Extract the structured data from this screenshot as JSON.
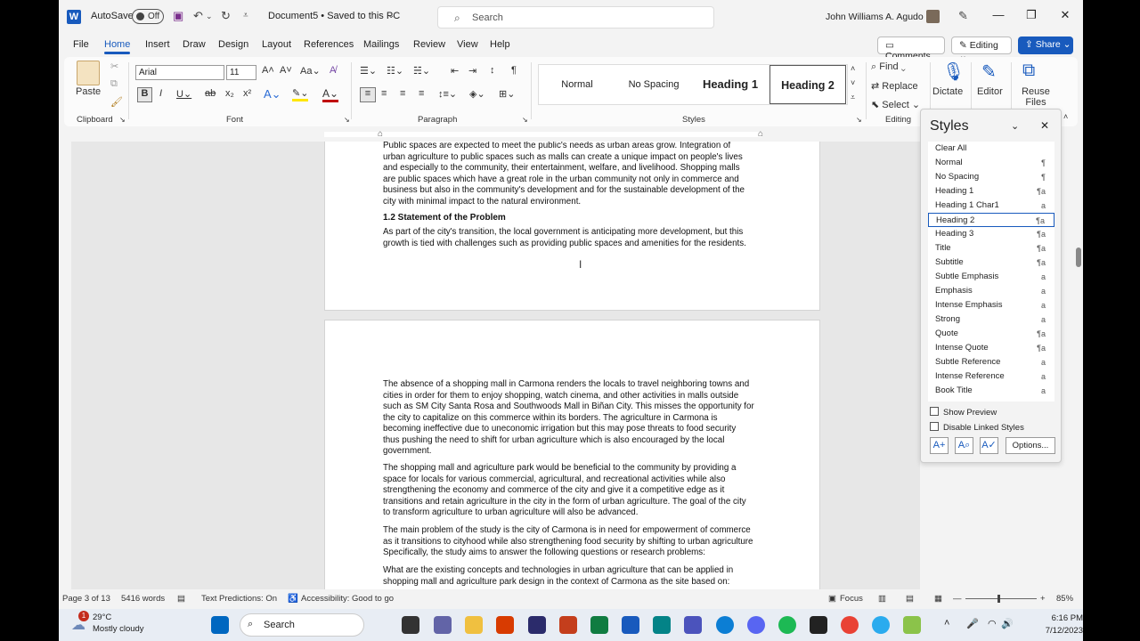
{
  "titlebar": {
    "autosave_label": "AutoSave",
    "autosave_state": "Off",
    "doc_title": "Document5 • Saved to this PC",
    "search_placeholder": "Search",
    "user_name": "John Williams A. Agudo"
  },
  "menu": {
    "items": [
      "File",
      "Home",
      "Insert",
      "Draw",
      "Design",
      "Layout",
      "References",
      "Mailings",
      "Review",
      "View",
      "Help"
    ],
    "active": "Home",
    "comments": "Comments",
    "editing": "Editing",
    "share": "Share"
  },
  "ribbon": {
    "clipboard": {
      "paste": "Paste",
      "label": "Clipboard"
    },
    "font": {
      "family": "Arial",
      "size": "11",
      "label": "Font"
    },
    "paragraph": {
      "label": "Paragraph"
    },
    "styles": {
      "label": "Styles",
      "tiles": [
        "Normal",
        "No Spacing",
        "Heading 1",
        "Heading 2"
      ],
      "selected": "Heading 2"
    },
    "editing": {
      "find": "Find",
      "replace": "Replace",
      "select": "Select",
      "label": "Editing"
    },
    "voice": {
      "dictate": "Dictate"
    },
    "editor": {
      "editor": "Editor"
    },
    "reuse": {
      "reuse": "Reuse Files"
    }
  },
  "page1": {
    "lines": [
      "Public spaces are expected to meet the public's needs as urban areas grow. Integration of",
      "urban agriculture to public spaces such as malls can create a unique impact on people's lives",
      "and especially to the community, their entertainment, welfare, and livelihood. Shopping malls",
      "are public spaces which have a great role in the urban community not only in commerce and",
      "business but also in the community's development and for the sustainable development of the",
      "city with minimal impact to the natural environment."
    ],
    "heading": "1.2 Statement of the Problem",
    "para2": [
      "As part of the city's transition, the local government is anticipating more development, but this",
      "growth is tied with challenges such as providing public spaces and amenities for the residents."
    ]
  },
  "page2": {
    "paragraphs": [
      [
        "The absence of a shopping mall in Carmona renders the locals to travel neighboring towns and",
        "cities in order for them to enjoy shopping, watch cinema, and other activities in malls outside",
        "such as SM City Santa Rosa and Southwoods Mall in Biñan City. This misses the opportunity for",
        "the city to capitalize on this commerce within its borders. The agriculture in Carmona is",
        "becoming ineffective due to uneconomic irrigation but this may pose threats to food security",
        "thus pushing the need to shift for urban agriculture which is also encouraged by the local",
        "government."
      ],
      [
        "The shopping mall and agriculture park would be beneficial to the community by providing a",
        "space for locals for various commercial, agricultural, and recreational activities while also",
        "strengthening the economy and commerce of the city and give it a competitive edge as it",
        "transitions and retain agriculture in the city in the form of urban agriculture. The goal of the city",
        "to transform agriculture to urban agriculture will also be advanced."
      ],
      [
        "The main problem of the study is the city of Carmona is in need for empowerment of commerce",
        "as it transitions to cityhood while also strengthening food security by shifting to urban agriculture",
        "Specifically, the study aims to answer the following questions or research problems:"
      ],
      [
        "What are the existing concepts and technologies in urban agriculture that can be applied in",
        "shopping mall and agriculture park design in the context of Carmona as the site based on:"
      ]
    ]
  },
  "styles_pane": {
    "title": "Styles",
    "items": [
      {
        "name": "Clear All",
        "mark": ""
      },
      {
        "name": "Normal",
        "mark": "¶"
      },
      {
        "name": "No Spacing",
        "mark": "¶"
      },
      {
        "name": "Heading 1",
        "mark": "¶a"
      },
      {
        "name": "Heading 1 Char1",
        "mark": "a"
      },
      {
        "name": "Heading 2",
        "mark": "¶a"
      },
      {
        "name": "Heading 3",
        "mark": "¶a"
      },
      {
        "name": "Title",
        "mark": "¶a"
      },
      {
        "name": "Subtitle",
        "mark": "¶a"
      },
      {
        "name": "Subtle Emphasis",
        "mark": "a"
      },
      {
        "name": "Emphasis",
        "mark": "a"
      },
      {
        "name": "Intense Emphasis",
        "mark": "a"
      },
      {
        "name": "Strong",
        "mark": "a"
      },
      {
        "name": "Quote",
        "mark": "¶a"
      },
      {
        "name": "Intense Quote",
        "mark": "¶a"
      },
      {
        "name": "Subtle Reference",
        "mark": "a"
      },
      {
        "name": "Intense Reference",
        "mark": "a"
      },
      {
        "name": "Book Title",
        "mark": "a"
      }
    ],
    "selected": "Heading 2",
    "show_preview": "Show Preview",
    "disable_linked": "Disable Linked Styles",
    "options": "Options..."
  },
  "status": {
    "page": "Page 3 of 13",
    "words": "5416 words",
    "predictions": "Text Predictions: On",
    "accessibility": "Accessibility: Good to go",
    "focus": "Focus",
    "zoom": "85%"
  },
  "taskbar": {
    "temp": "29°C",
    "weather": "Mostly cloudy",
    "badge": "1",
    "search": "Search",
    "time": "6:16 PM",
    "date": "7/12/2023"
  }
}
